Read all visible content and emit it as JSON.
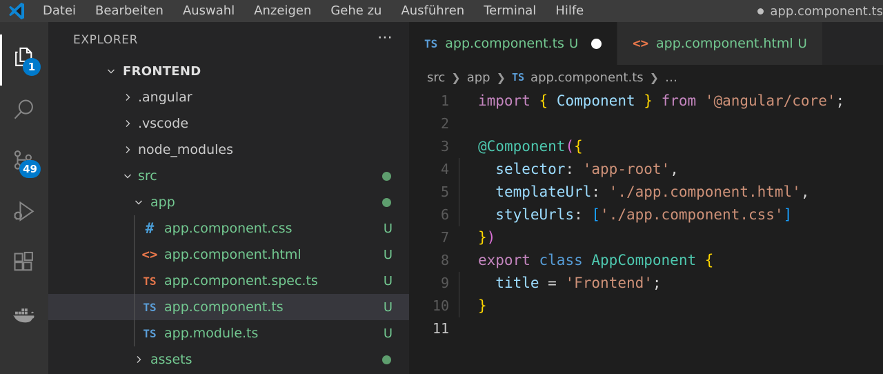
{
  "titlebar": {
    "logo_icon": "vscode-logo-icon",
    "menu": [
      {
        "label": "Datei"
      },
      {
        "label": "Bearbeiten"
      },
      {
        "label": "Auswahl"
      },
      {
        "label": "Anzeigen"
      },
      {
        "label": "Gehe zu"
      },
      {
        "label": "Ausführen"
      },
      {
        "label": "Terminal"
      },
      {
        "label": "Hilfe"
      }
    ],
    "window_title": "app.component.ts",
    "dirty_indicator": "●"
  },
  "activitybar": {
    "items": [
      {
        "name": "explorer",
        "icon": "files-icon",
        "badge": "1",
        "active": true
      },
      {
        "name": "search",
        "icon": "search-icon",
        "badge": "",
        "active": false
      },
      {
        "name": "source-control",
        "icon": "source-control-icon",
        "badge": "49",
        "active": false
      },
      {
        "name": "run-and-debug",
        "icon": "run-debug-icon",
        "badge": "",
        "active": false
      },
      {
        "name": "extensions",
        "icon": "extensions-icon",
        "badge": "",
        "active": false
      },
      {
        "name": "docker",
        "icon": "docker-whale-icon",
        "badge": "",
        "active": false
      }
    ]
  },
  "sidebar": {
    "title": "EXPLORER",
    "more_actions": "…",
    "root": {
      "label": "FRONTEND",
      "expanded": true
    },
    "tree": [
      {
        "label": ".angular",
        "type": "folder",
        "expanded": false,
        "indent": 0,
        "color": "grey",
        "badge": "",
        "dot": false
      },
      {
        "label": ".vscode",
        "type": "folder",
        "expanded": false,
        "indent": 0,
        "color": "grey",
        "badge": "",
        "dot": false
      },
      {
        "label": "node_modules",
        "type": "folder",
        "expanded": false,
        "indent": 0,
        "color": "grey",
        "badge": "",
        "dot": false
      },
      {
        "label": "src",
        "type": "folder",
        "expanded": true,
        "indent": 0,
        "color": "green",
        "badge": "",
        "dot": true
      },
      {
        "label": "app",
        "type": "folder",
        "expanded": true,
        "indent": 1,
        "color": "green",
        "badge": "",
        "dot": true
      },
      {
        "label": "app.component.css",
        "type": "file",
        "icon": "css-icon",
        "indent": 2,
        "color": "green",
        "badge": "U",
        "dot": false,
        "selected": false
      },
      {
        "label": "app.component.html",
        "type": "file",
        "icon": "html-icon",
        "indent": 2,
        "color": "green",
        "badge": "U",
        "dot": false,
        "selected": false
      },
      {
        "label": "app.component.spec.ts",
        "type": "file",
        "icon": "ts-orange-icon",
        "indent": 2,
        "color": "green",
        "badge": "U",
        "dot": false,
        "selected": false
      },
      {
        "label": "app.component.ts",
        "type": "file",
        "icon": "ts-blue-icon",
        "indent": 2,
        "color": "green",
        "badge": "U",
        "dot": false,
        "selected": true
      },
      {
        "label": "app.module.ts",
        "type": "file",
        "icon": "ts-blue-icon",
        "indent": 2,
        "color": "green",
        "badge": "U",
        "dot": false,
        "selected": false
      },
      {
        "label": "assets",
        "type": "folder",
        "expanded": false,
        "indent": 1,
        "color": "green",
        "badge": "",
        "dot": true
      }
    ]
  },
  "editor": {
    "tabs": [
      {
        "icon": "ts-icon",
        "label": "app.component.ts",
        "status": "U",
        "dirty": true,
        "active": true
      },
      {
        "icon": "html-icon",
        "label": "app.component.html",
        "status": "U",
        "dirty": false,
        "active": false
      }
    ],
    "breadcrumb": [
      {
        "text": "src",
        "icon": ""
      },
      {
        "text": "app",
        "icon": ""
      },
      {
        "text": "app.component.ts",
        "icon": "TS"
      },
      {
        "text": "…",
        "icon": ""
      }
    ],
    "breadcrumb_separator": "❯",
    "current_line": 11,
    "lines": [
      {
        "n": "1",
        "tokens": [
          {
            "t": "import",
            "c": "t-kw"
          },
          {
            "t": " ",
            "c": "t-plain"
          },
          {
            "t": "{",
            "c": "t-br1"
          },
          {
            "t": " ",
            "c": "t-plain"
          },
          {
            "t": "Component",
            "c": "t-var"
          },
          {
            "t": " ",
            "c": "t-plain"
          },
          {
            "t": "}",
            "c": "t-br1"
          },
          {
            "t": " ",
            "c": "t-plain"
          },
          {
            "t": "from",
            "c": "t-kw"
          },
          {
            "t": " ",
            "c": "t-plain"
          },
          {
            "t": "'@angular/core'",
            "c": "t-str"
          },
          {
            "t": ";",
            "c": "t-plain"
          }
        ]
      },
      {
        "n": "2",
        "tokens": []
      },
      {
        "n": "3",
        "tokens": [
          {
            "t": "@",
            "c": "t-type"
          },
          {
            "t": "Component",
            "c": "t-type"
          },
          {
            "t": "(",
            "c": "t-br2"
          },
          {
            "t": "{",
            "c": "t-br1"
          }
        ]
      },
      {
        "n": "4",
        "tokens": [
          {
            "t": "  ",
            "c": "t-plain"
          },
          {
            "t": "selector",
            "c": "t-var"
          },
          {
            "t": ": ",
            "c": "t-plain"
          },
          {
            "t": "'app-root'",
            "c": "t-str"
          },
          {
            "t": ",",
            "c": "t-plain"
          }
        ]
      },
      {
        "n": "5",
        "tokens": [
          {
            "t": "  ",
            "c": "t-plain"
          },
          {
            "t": "templateUrl",
            "c": "t-var"
          },
          {
            "t": ": ",
            "c": "t-plain"
          },
          {
            "t": "'./app.component.html'",
            "c": "t-str"
          },
          {
            "t": ",",
            "c": "t-plain"
          }
        ]
      },
      {
        "n": "6",
        "tokens": [
          {
            "t": "  ",
            "c": "t-plain"
          },
          {
            "t": "styleUrls",
            "c": "t-var"
          },
          {
            "t": ": ",
            "c": "t-plain"
          },
          {
            "t": "[",
            "c": "t-br3"
          },
          {
            "t": "'./app.component.css'",
            "c": "t-str"
          },
          {
            "t": "]",
            "c": "t-br3"
          }
        ]
      },
      {
        "n": "7",
        "tokens": [
          {
            "t": "}",
            "c": "t-br1"
          },
          {
            "t": ")",
            "c": "t-br2"
          }
        ]
      },
      {
        "n": "8",
        "tokens": [
          {
            "t": "export",
            "c": "t-kw"
          },
          {
            "t": " ",
            "c": "t-plain"
          },
          {
            "t": "class",
            "c": "t-kw2"
          },
          {
            "t": " ",
            "c": "t-plain"
          },
          {
            "t": "AppComponent",
            "c": "t-type"
          },
          {
            "t": " ",
            "c": "t-plain"
          },
          {
            "t": "{",
            "c": "t-br1"
          }
        ]
      },
      {
        "n": "9",
        "tokens": [
          {
            "t": "  ",
            "c": "t-plain"
          },
          {
            "t": "title",
            "c": "t-var"
          },
          {
            "t": " ",
            "c": "t-plain"
          },
          {
            "t": "=",
            "c": "t-plain"
          },
          {
            "t": " ",
            "c": "t-plain"
          },
          {
            "t": "'Frontend'",
            "c": "t-str"
          },
          {
            "t": ";",
            "c": "t-plain"
          }
        ]
      },
      {
        "n": "10",
        "tokens": [
          {
            "t": "}",
            "c": "t-br1"
          }
        ]
      },
      {
        "n": "11",
        "tokens": []
      }
    ]
  },
  "colors": {
    "titlebar_bg": "#3c3c3c",
    "activitybar_bg": "#333333",
    "sidebar_bg": "#252526",
    "editor_bg": "#1e1e1e",
    "badge_bg": "#007acc",
    "git_untracked": "#73c991",
    "selection_bg": "#37373d"
  }
}
